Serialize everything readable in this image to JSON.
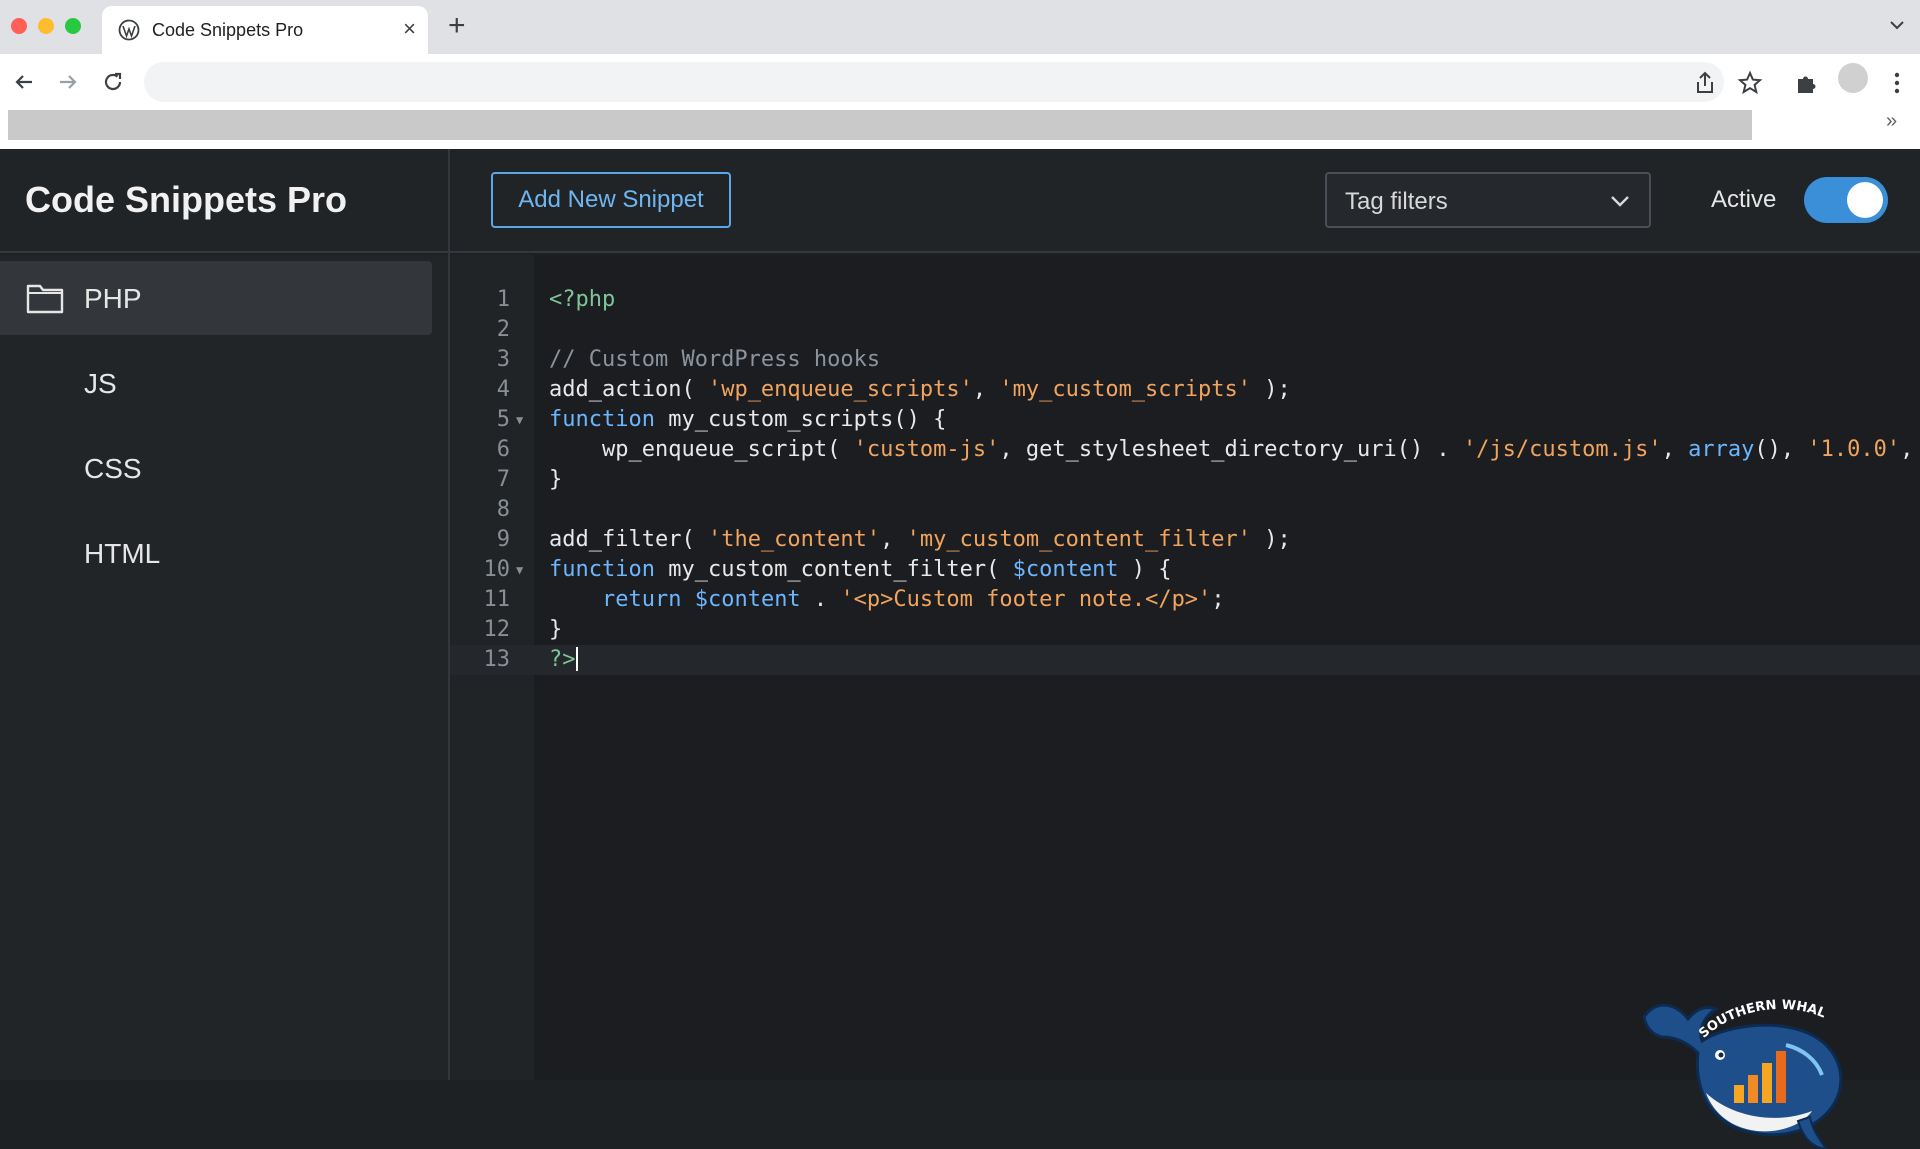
{
  "browser": {
    "tab_title": "Code Snippets Pro",
    "tab_close": "×",
    "new_tab": "+",
    "bookmarks_overflow": "»"
  },
  "app": {
    "brand": "Code Snippets Pro",
    "add_button_label": "Add New Snippet",
    "tag_filter_label": "Tag filters",
    "active_label": "Active",
    "active_toggle_on": true
  },
  "sidebar": {
    "items": [
      {
        "label": "PHP",
        "active": true
      },
      {
        "label": "JS",
        "active": false
      },
      {
        "label": "CSS",
        "active": false
      },
      {
        "label": "HTML",
        "active": false
      }
    ]
  },
  "editor": {
    "language": "php",
    "current_line": 13,
    "lines": [
      {
        "n": "1",
        "fold": false,
        "tokens": [
          [
            "<?php",
            "#7ec699"
          ]
        ]
      },
      {
        "n": "2",
        "fold": false,
        "tokens": []
      },
      {
        "n": "3",
        "fold": false,
        "tokens": [
          [
            "// Custom WordPress hooks",
            "#8b949e"
          ]
        ]
      },
      {
        "n": "4",
        "fold": false,
        "tokens": [
          [
            "add_action( ",
            "#e8e8e8"
          ],
          [
            "'wp_enqueue_scripts'",
            "#f0a45d"
          ],
          [
            ", ",
            "#e8e8e8"
          ],
          [
            "'my_custom_scripts'",
            "#f0a45d"
          ],
          [
            " );",
            "#e8e8e8"
          ]
        ]
      },
      {
        "n": "5",
        "fold": true,
        "tokens": [
          [
            "function",
            "#6cb6ff"
          ],
          [
            " my_custom_scripts() {",
            "#e8e8e8"
          ]
        ]
      },
      {
        "n": "6",
        "fold": false,
        "tokens": [
          [
            "    wp_enqueue_script( ",
            "#e8e8e8"
          ],
          [
            "'custom-js'",
            "#f0a45d"
          ],
          [
            ", get_stylesheet_directory_uri() . ",
            "#e8e8e8"
          ],
          [
            "'/js/custom.js'",
            "#f0a45d"
          ],
          [
            ", ",
            "#e8e8e8"
          ],
          [
            "array",
            "#6cb6ff"
          ],
          [
            "(), ",
            "#e8e8e8"
          ],
          [
            "'1.0.0'",
            "#f0a45d"
          ],
          [
            ", ",
            "#e8e8e8"
          ],
          [
            "true",
            "#6cb6ff"
          ],
          [
            " )",
            "#e8e8e8"
          ]
        ]
      },
      {
        "n": "7",
        "fold": false,
        "tokens": [
          [
            "}",
            "#e8e8e8"
          ]
        ]
      },
      {
        "n": "8",
        "fold": false,
        "tokens": []
      },
      {
        "n": "9",
        "fold": false,
        "tokens": [
          [
            "add_filter( ",
            "#e8e8e8"
          ],
          [
            "'the_content'",
            "#f0a45d"
          ],
          [
            ", ",
            "#e8e8e8"
          ],
          [
            "'my_custom_content_filter'",
            "#f0a45d"
          ],
          [
            " );",
            "#e8e8e8"
          ]
        ]
      },
      {
        "n": "10",
        "fold": true,
        "tokens": [
          [
            "function",
            "#6cb6ff"
          ],
          [
            " my_custom_content_filter( ",
            "#e8e8e8"
          ],
          [
            "$content",
            "#6cb6ff"
          ],
          [
            " ) {",
            "#e8e8e8"
          ]
        ]
      },
      {
        "n": "11",
        "fold": false,
        "tokens": [
          [
            "    ",
            "#e8e8e8"
          ],
          [
            "return",
            "#6cb6ff"
          ],
          [
            " ",
            "#e8e8e8"
          ],
          [
            "$content",
            "#6cb6ff"
          ],
          [
            " . ",
            "#e8e8e8"
          ],
          [
            "'<p>Custom footer note.</p>'",
            "#f0a45d"
          ],
          [
            ";",
            "#e8e8e8"
          ]
        ]
      },
      {
        "n": "12",
        "fold": false,
        "tokens": [
          [
            "}",
            "#e8e8e8"
          ]
        ]
      },
      {
        "n": "13",
        "fold": false,
        "tokens": [
          [
            "?>",
            "#7ec699"
          ]
        ]
      }
    ]
  },
  "watermark": {
    "text": "SOUTHERN WHALE"
  },
  "colors": {
    "accent": "#3b8ed8",
    "string": "#f0a45d",
    "keyword": "#6cb6ff",
    "php_tag": "#7ec699",
    "comment": "#8b949e"
  }
}
